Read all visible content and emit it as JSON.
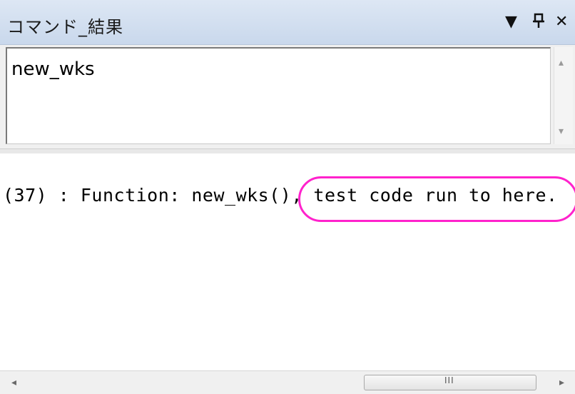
{
  "window": {
    "title": "コマンド_結果",
    "buttons": {
      "dropdown": "▼",
      "pin": "ᵽ",
      "close": "✕"
    }
  },
  "command": {
    "value": "new_wks"
  },
  "results": {
    "line": "(37) : Function: new_wks(), test code run to here.",
    "highlighted_text": ", test code run to here."
  },
  "scrollbar": {
    "left_arrow": "◂",
    "right_arrow": "▸",
    "up_arrow": "▴",
    "down_arrow": "▾",
    "grip": "III"
  },
  "colors": {
    "highlight": "#ff22cc",
    "titlebar": "#c9d8ec"
  }
}
